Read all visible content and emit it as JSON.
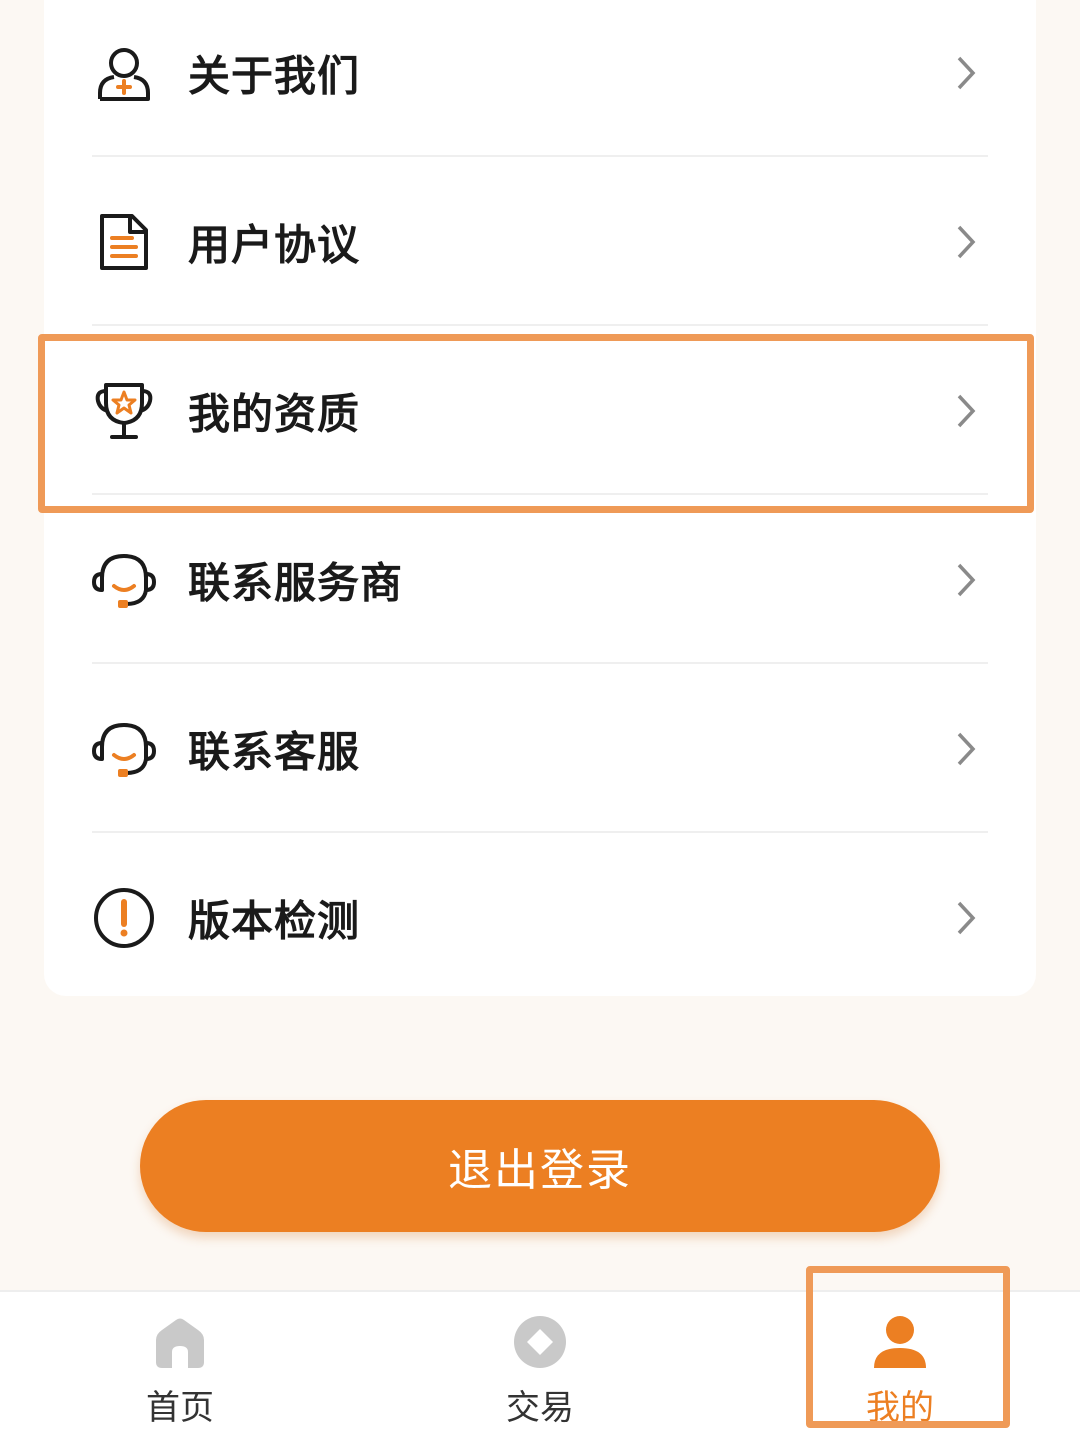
{
  "menu": {
    "items": [
      {
        "label": "关于我们",
        "icon": "about-us-icon"
      },
      {
        "label": "用户协议",
        "icon": "document-icon"
      },
      {
        "label": "我的资质",
        "icon": "trophy-icon"
      },
      {
        "label": "联系服务商",
        "icon": "headset-icon"
      },
      {
        "label": "联系客服",
        "icon": "headset-icon"
      },
      {
        "label": "版本检测",
        "icon": "alert-circle-icon"
      }
    ]
  },
  "logout_button": {
    "label": "退出登录"
  },
  "tabbar": {
    "tabs": [
      {
        "label": "首页",
        "icon": "home-icon",
        "active": false
      },
      {
        "label": "交易",
        "icon": "trade-icon",
        "active": false
      },
      {
        "label": "我的",
        "icon": "user-icon",
        "active": true
      }
    ]
  },
  "colors": {
    "accent": "#ec7f22",
    "highlight_border": "#ef9a57",
    "background": "#fcf8f3",
    "inactive_icon": "#c9c9c9"
  }
}
